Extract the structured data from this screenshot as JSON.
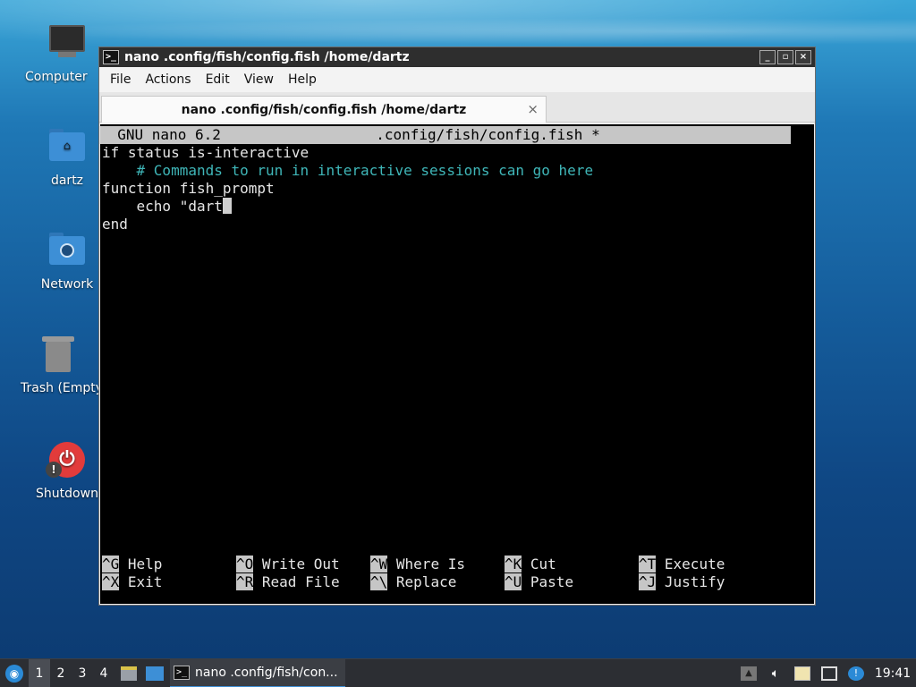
{
  "desktop": {
    "icons": [
      {
        "label": "Computer"
      },
      {
        "label": "dartz"
      },
      {
        "label": "Network"
      },
      {
        "label": "Trash (Empty)"
      },
      {
        "label": "Shutdown"
      }
    ]
  },
  "window": {
    "title": "nano .config/fish/config.fish  /home/dartz",
    "app_icon": ">_",
    "buttons": {
      "minimize": "_",
      "maximize": "▫",
      "close": "×"
    },
    "menu": [
      "File",
      "Actions",
      "Edit",
      "View",
      "Help"
    ],
    "tab": {
      "label": "nano .config/fish/config.fish  /home/dartz",
      "close": "×"
    }
  },
  "nano": {
    "header": "  GNU nano 6.2                  .config/fish/config.fish *",
    "lines": [
      "if status is-interactive",
      "    # Commands to run in interactive sessions can go here",
      "function fish_prompt",
      "    echo \"dart",
      "end"
    ],
    "shortcuts": [
      {
        "key": "^G",
        "label": "Help"
      },
      {
        "key": "^X",
        "label": "Exit"
      },
      {
        "key": "^O",
        "label": "Write Out"
      },
      {
        "key": "^R",
        "label": "Read File"
      },
      {
        "key": "^W",
        "label": "Where Is"
      },
      {
        "key": "^\\",
        "label": "Replace"
      },
      {
        "key": "^K",
        "label": "Cut"
      },
      {
        "key": "^U",
        "label": "Paste"
      },
      {
        "key": "^T",
        "label": "Execute"
      },
      {
        "key": "^J",
        "label": "Justify"
      }
    ],
    "colors": {
      "comment": "#3fb6b8",
      "background": "#000000",
      "header_bg": "#c6c6c6"
    }
  },
  "taskbar": {
    "workspaces": [
      "1",
      "2",
      "3",
      "4"
    ],
    "active_workspace": "1",
    "task_label": "nano .config/fish/con...",
    "clock": "19:41",
    "tray_icons": [
      "overflow-icon",
      "volume-icon",
      "clipboard-icon",
      "network-icon",
      "update-icon"
    ]
  }
}
